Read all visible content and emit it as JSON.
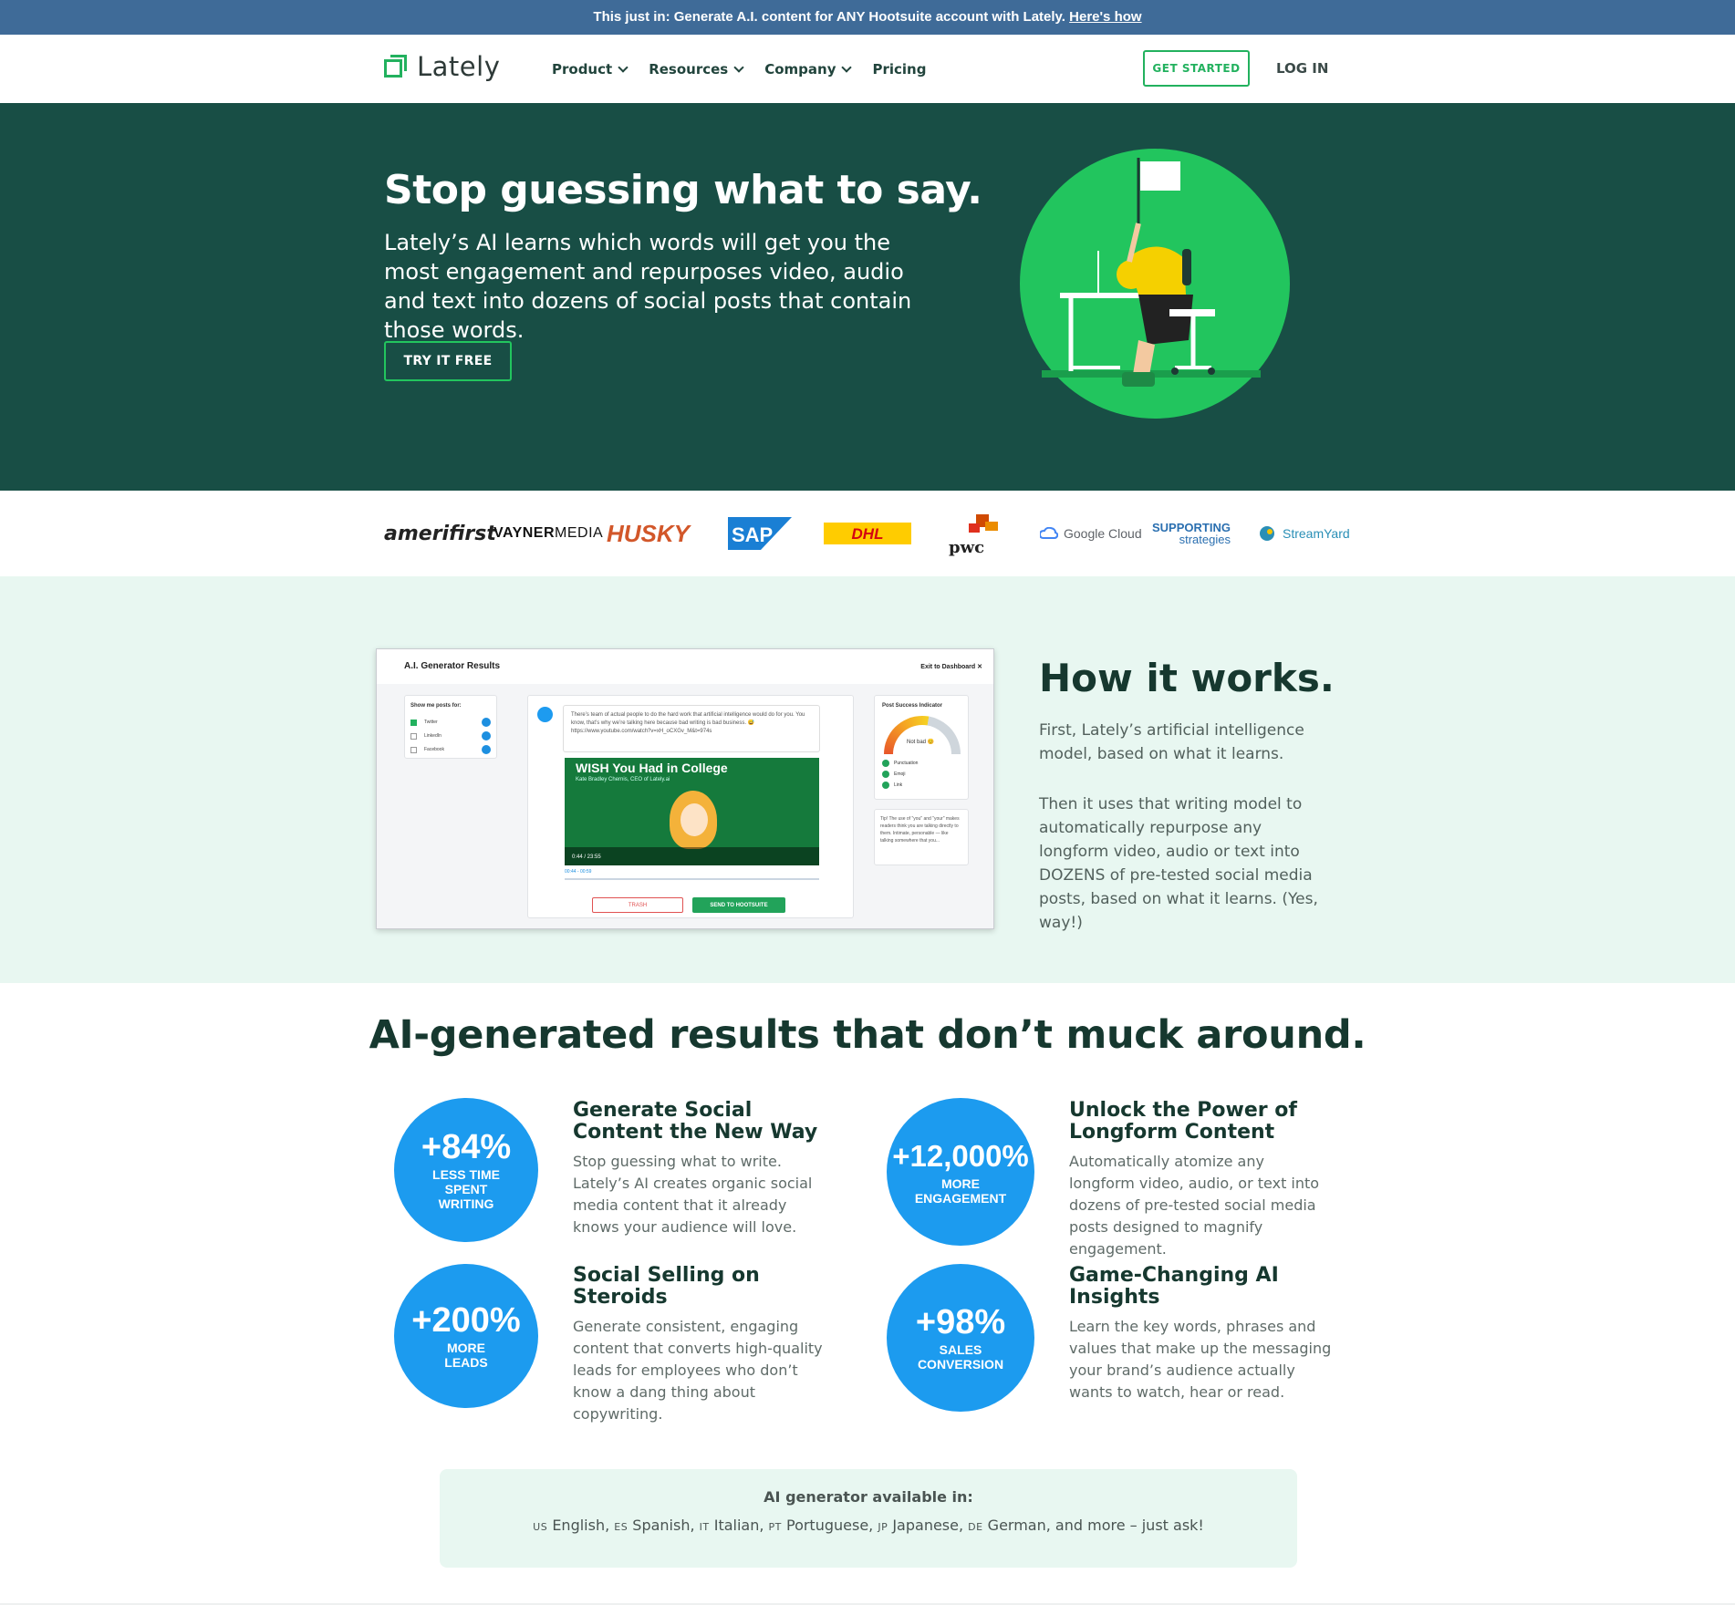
{
  "announcement": {
    "text": "This just in: Generate A.I. content for ANY Hootsuite account with Lately.",
    "link": "Here's how"
  },
  "nav": {
    "logo": "Lately",
    "links": [
      "Product",
      "Resources",
      "Company",
      "Pricing"
    ],
    "get_started": "GET STARTED",
    "login": "LOG IN"
  },
  "hero": {
    "title": "Stop guessing what to say.",
    "subtitle": "Lately’s AI learns which words will get you the most engagement and repurposes video, audio and text into dozens of social posts that contain those words.",
    "cta": "TRY IT FREE"
  },
  "logos": {
    "amerifirst": "amerifirst",
    "vayner_a": "VAYNER",
    "vayner_b": "MEDIA",
    "husky": "HUSKY",
    "sap": "SAP",
    "dhl": "DHL",
    "pwc": "pwc",
    "google": "Google Cloud",
    "supporting_a": "SUPPORTING",
    "supporting_b": "strategies",
    "streamyard": "StreamYard"
  },
  "how": {
    "title": "How it works.",
    "p1": "First, Lately’s artificial intelligence model, based on what it learns.",
    "p2": "Then it uses that writing model to automatically repurpose any longform video, audio or text into DOZENS of pre-tested social media posts, based on what it learns. (Yes, way!)",
    "mock": {
      "title": "A.I. Generator Results",
      "exit": "Exit to Dashboard ✕",
      "filter_head": "Show me posts for:",
      "filters": [
        "Twitter",
        "LinkedIn",
        "Facebook"
      ],
      "post_text": "There’s team of actual people to do the hard work that artificial intelligence would do for you. You know, that’s why we’re talking here because bad writing is bad business. 😅 https://www.youtube.com/watch?v=xH_oCXGv_M&t=974s",
      "video_title": "WISH You Had in College",
      "video_sub": "Kate Bradley Chernis, CEO of Lately.ai",
      "video_time": "0:44 / 23:55",
      "clip_range": "00:44 - 00:59",
      "trash": "TRASH",
      "send": "SEND TO HOOTSUITE",
      "indicator_head": "Post Success Indicator",
      "gauge_label": "Not bad 😊",
      "checks": [
        "Punctuation",
        "Emoji",
        "Link"
      ],
      "tip": "Tip! The use of \"you\" and \"your\" makes readers think you are talking directly to them. Intimate, personable — like talking somewhere that you...",
      "gauge_fraction": 0.55
    }
  },
  "results": {
    "title": "AI-generated results that don’t muck around.",
    "items": [
      {
        "stat": "+84%",
        "stat_label": "LESS TIME SPENT WRITING",
        "heading": "Generate Social Content the New Way",
        "body": "Stop guessing what to write. Lately’s AI creates organic social media content that it already knows your audience will love."
      },
      {
        "stat": "+12,000%",
        "stat_label": "MORE ENGAGEMENT",
        "heading": "Unlock the Power of Longform Content",
        "body": "Automatically atomize any longform video, audio, or text into dozens of pre-tested social media posts designed to magnify engagement."
      },
      {
        "stat": "+200%",
        "stat_label": "MORE LEADS",
        "heading": "Social Selling on Steroids",
        "body": "Generate consistent, engaging content that converts high-quality leads for employees who don’t know a dang thing about copywriting."
      },
      {
        "stat": "+98%",
        "stat_label": "SALES CONVERSION",
        "heading": "Game-Changing AI Insights",
        "body": "Learn the key words, phrases and values that make up the messaging your brand’s audience actually wants to watch, hear or read."
      }
    ]
  },
  "languages": {
    "heading": "AI generator available in:",
    "items": [
      {
        "code": "US",
        "name": "English"
      },
      {
        "code": "ES",
        "name": "Spanish"
      },
      {
        "code": "IT",
        "name": "Italian"
      },
      {
        "code": "PT",
        "name": "Portuguese"
      },
      {
        "code": "JP",
        "name": "Japanese"
      },
      {
        "code": "DE",
        "name": "German"
      }
    ],
    "tail": "and more – just ask!"
  },
  "colors": {
    "announcement": "#3f6b98",
    "hero_bg": "#184e45",
    "brand_green": "#22b15e",
    "section_mint": "#e8f7f1",
    "stat_blue": "#1c9bef",
    "heading_dark": "#16382f"
  }
}
